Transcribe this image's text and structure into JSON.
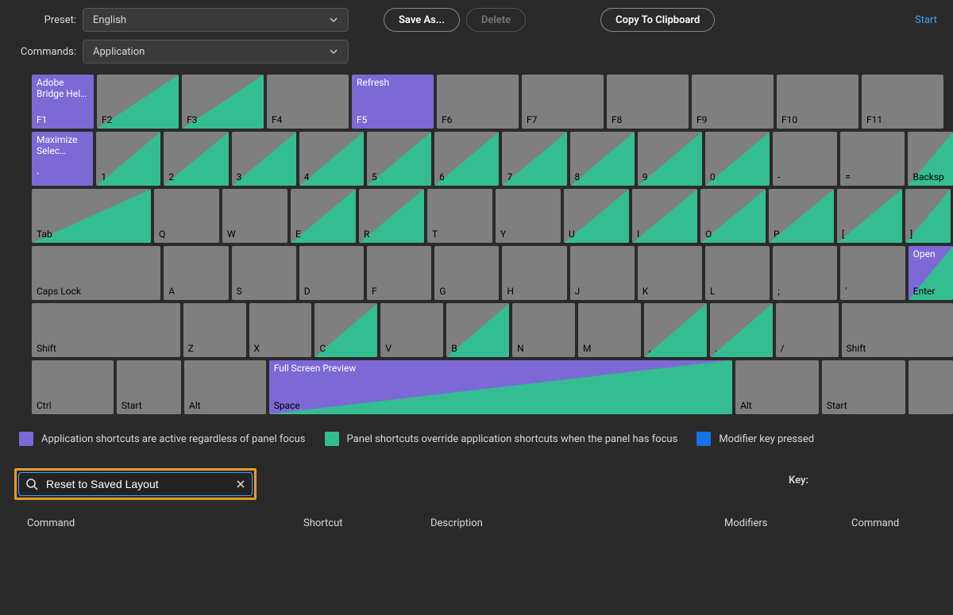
{
  "labels": {
    "preset": "Preset:",
    "commands": "Commands:"
  },
  "preset": {
    "value": "English"
  },
  "commands": {
    "value": "Application"
  },
  "buttons": {
    "saveAs": "Save As...",
    "delete": "Delete",
    "copy": "Copy To Clipboard"
  },
  "link": {
    "start": "Start"
  },
  "legend": {
    "app": "Application shortcuts are active regardless of panel focus",
    "panel": "Panel shortcuts override application shortcuts when the panel has focus",
    "mod": "Modifier key pressed"
  },
  "search": {
    "value": "Reset to Saved Layout"
  },
  "keyLabel": "Key:",
  "columns": {
    "command": "Command",
    "shortcut": "Shortcut",
    "description": "Description",
    "modifiers": "Modifiers",
    "command2": "Command"
  },
  "keys": {
    "r1": [
      {
        "top": "Adobe Bridge Hel…",
        "bot": "F1",
        "style": "purple"
      },
      {
        "top": "",
        "bot": "F2",
        "style": "tri"
      },
      {
        "top": "",
        "bot": "F3",
        "style": "tri"
      },
      {
        "top": "",
        "bot": "F4",
        "style": "plain"
      },
      {
        "top": "Refresh",
        "bot": "F5",
        "style": "purple"
      },
      {
        "top": "",
        "bot": "F6",
        "style": "plain"
      },
      {
        "top": "",
        "bot": "F7",
        "style": "plain"
      },
      {
        "top": "",
        "bot": "F8",
        "style": "plain"
      },
      {
        "top": "",
        "bot": "F9",
        "style": "plain"
      },
      {
        "top": "",
        "bot": "F10",
        "style": "plain"
      },
      {
        "top": "",
        "bot": "F11",
        "style": "plain"
      }
    ],
    "r2": [
      {
        "top": "Maximize Selec…",
        "bot": "`",
        "style": "purple",
        "w": "wF1"
      },
      {
        "top": "",
        "bot": "1",
        "style": "tri",
        "w": "num"
      },
      {
        "top": "",
        "bot": "2",
        "style": "tri",
        "w": "num"
      },
      {
        "top": "",
        "bot": "3",
        "style": "tri",
        "w": "num"
      },
      {
        "top": "",
        "bot": "4",
        "style": "tri",
        "w": "num"
      },
      {
        "top": "",
        "bot": "5",
        "style": "tri",
        "w": "num"
      },
      {
        "top": "",
        "bot": "6",
        "style": "tri",
        "w": "num"
      },
      {
        "top": "",
        "bot": "7",
        "style": "tri",
        "w": "num"
      },
      {
        "top": "",
        "bot": "8",
        "style": "tri",
        "w": "num"
      },
      {
        "top": "",
        "bot": "9",
        "style": "tri",
        "w": "num"
      },
      {
        "top": "",
        "bot": "0",
        "style": "tri",
        "w": "num"
      },
      {
        "top": "",
        "bot": "-",
        "style": "plain",
        "w": "num"
      },
      {
        "top": "",
        "bot": "=",
        "style": "plain",
        "w": "num"
      },
      {
        "top": "",
        "bot": "Backsp",
        "style": "tri",
        "w": "wEnter"
      }
    ],
    "r3": [
      {
        "top": "",
        "bot": "Tab",
        "style": "tri",
        "w": "wTab"
      },
      {
        "top": "",
        "bot": "Q",
        "style": "plain",
        "w": "num"
      },
      {
        "top": "",
        "bot": "W",
        "style": "plain",
        "w": "num"
      },
      {
        "top": "",
        "bot": "E",
        "style": "tri",
        "w": "num"
      },
      {
        "top": "",
        "bot": "R",
        "style": "tri",
        "w": "num"
      },
      {
        "top": "",
        "bot": "T",
        "style": "plain",
        "w": "num"
      },
      {
        "top": "",
        "bot": "Y",
        "style": "plain",
        "w": "num"
      },
      {
        "top": "",
        "bot": "U",
        "style": "tri",
        "w": "num"
      },
      {
        "top": "",
        "bot": "I",
        "style": "tri",
        "w": "num"
      },
      {
        "top": "",
        "bot": "O",
        "style": "tri",
        "w": "num"
      },
      {
        "top": "",
        "bot": "P",
        "style": "tri",
        "w": "num"
      },
      {
        "top": "",
        "bot": "[",
        "style": "tri",
        "w": "num"
      },
      {
        "top": "",
        "bot": "]",
        "style": "tri",
        "w": "wEnter"
      }
    ],
    "r4": [
      {
        "top": "",
        "bot": "Caps Lock",
        "style": "plain",
        "w": "wCaps"
      },
      {
        "top": "",
        "bot": "A",
        "style": "plain",
        "w": "num"
      },
      {
        "top": "",
        "bot": "S",
        "style": "plain",
        "w": "num"
      },
      {
        "top": "",
        "bot": "D",
        "style": "plain",
        "w": "num"
      },
      {
        "top": "",
        "bot": "F",
        "style": "plain",
        "w": "num"
      },
      {
        "top": "",
        "bot": "G",
        "style": "plain",
        "w": "num"
      },
      {
        "top": "",
        "bot": "H",
        "style": "plain",
        "w": "num"
      },
      {
        "top": "",
        "bot": "J",
        "style": "plain",
        "w": "num"
      },
      {
        "top": "",
        "bot": "K",
        "style": "plain",
        "w": "num"
      },
      {
        "top": "",
        "bot": "L",
        "style": "plain",
        "w": "num"
      },
      {
        "top": "",
        "bot": ";",
        "style": "plain",
        "w": "num"
      },
      {
        "top": "",
        "bot": "'",
        "style": "plain",
        "w": "num"
      },
      {
        "top": "Open",
        "bot": "Enter",
        "style": "split",
        "w": "wEnter"
      }
    ],
    "r5": [
      {
        "top": "",
        "bot": "Shift",
        "style": "plain",
        "w": "wShift"
      },
      {
        "top": "",
        "bot": "Z",
        "style": "plain",
        "w": "num"
      },
      {
        "top": "",
        "bot": "X",
        "style": "plain",
        "w": "num"
      },
      {
        "top": "",
        "bot": "C",
        "style": "tri",
        "w": "num"
      },
      {
        "top": "",
        "bot": "V",
        "style": "plain",
        "w": "num"
      },
      {
        "top": "",
        "bot": "B",
        "style": "tri",
        "w": "num"
      },
      {
        "top": "",
        "bot": "N",
        "style": "plain",
        "w": "num"
      },
      {
        "top": "",
        "bot": "M",
        "style": "plain",
        "w": "num"
      },
      {
        "top": "",
        "bot": ",",
        "style": "tri",
        "w": "num"
      },
      {
        "top": "",
        "bot": ".",
        "style": "tri",
        "w": "num"
      },
      {
        "top": "",
        "bot": "/",
        "style": "plain",
        "w": "num"
      },
      {
        "top": "",
        "bot": "Shift",
        "style": "plain",
        "w": "wShiftR"
      }
    ],
    "r6": [
      {
        "top": "",
        "bot": "Ctrl",
        "style": "plain",
        "w": "wCtrl"
      },
      {
        "top": "",
        "bot": "Start",
        "style": "plain",
        "w": "wMod"
      },
      {
        "top": "",
        "bot": "Alt",
        "style": "plain",
        "w": "wCtrl"
      },
      {
        "top": "Full Screen Preview",
        "bot": "Space",
        "style": "split",
        "w": "wSpace"
      },
      {
        "top": "",
        "bot": "Alt",
        "style": "plain",
        "w": "wModR"
      },
      {
        "top": "",
        "bot": "Start",
        "style": "plain",
        "w": "wModR"
      },
      {
        "top": "",
        "bot": "",
        "style": "plain",
        "w": "wEnter"
      }
    ]
  }
}
